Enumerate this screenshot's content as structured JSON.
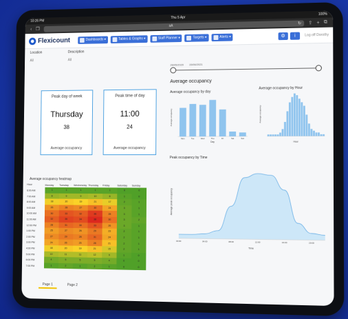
{
  "status": {
    "time": "10:26 PM",
    "date": "Thu 5 Apr",
    "battery": "100%"
  },
  "browser": {
    "url": "aA",
    "reload_icon": "reload-icon"
  },
  "app": {
    "name": "Flexicount"
  },
  "nav": {
    "items": [
      {
        "label": "Dashboards ▾"
      },
      {
        "label": "Tables & Graphs ▾"
      },
      {
        "label": "Staff Planner ▾"
      },
      {
        "label": "Targets ▾"
      },
      {
        "label": "Alerts ▾"
      }
    ],
    "settings_icon": "gear-icon",
    "info_label": "i",
    "logout_label": "Log off Dorothy"
  },
  "filters": {
    "location_label": "Location",
    "location_value": "All",
    "description_label": "Description",
    "description_value": "All"
  },
  "date_range": {
    "start": "26/05/2020",
    "end": "15/06/2021"
  },
  "kpis": [
    {
      "title": "Peak day of week",
      "main": "Thursday",
      "value": "38",
      "foot": "Average occupancy"
    },
    {
      "title": "Peak time of day",
      "main": "11:00",
      "value": "24",
      "foot": "Average occupancy"
    }
  ],
  "section_title": "Average occupancy",
  "by_day_title": "Average occupancy by day",
  "by_hour_title": "Average occupancy by Hour",
  "by_time_title": "Peak occupancy by Time",
  "heatmap": {
    "title": "Average occupancy heatmap",
    "corner": "Hour",
    "days": [
      "Monday",
      "Tuesday",
      "Wednesday",
      "Thursday",
      "Friday",
      "Saturday",
      "Sunday"
    ],
    "hours": [
      "6:00 AM",
      "7:00 AM",
      "8:00 AM",
      "9:00 AM",
      "10:00 AM",
      "11:00 AM",
      "12:00 PM",
      "1:00 PM",
      "2:00 PM",
      "3:00 PM",
      "4:00 PM",
      "5:00 PM",
      "6:00 PM",
      "7:00 PM"
    ],
    "values": [
      [
        1,
        1,
        1,
        1,
        1,
        0,
        0
      ],
      [
        8,
        9,
        9,
        10,
        8,
        1,
        0
      ],
      [
        18,
        20,
        19,
        21,
        17,
        2,
        1
      ],
      [
        26,
        28,
        27,
        30,
        24,
        3,
        1
      ],
      [
        30,
        33,
        32,
        36,
        28,
        3,
        1
      ],
      [
        32,
        35,
        34,
        38,
        30,
        3,
        2
      ],
      [
        28,
        31,
        30,
        33,
        26,
        3,
        1
      ],
      [
        25,
        27,
        26,
        29,
        23,
        2,
        1
      ],
      [
        27,
        29,
        28,
        31,
        24,
        2,
        1
      ],
      [
        24,
        26,
        25,
        28,
        21,
        2,
        1
      ],
      [
        18,
        20,
        19,
        21,
        15,
        2,
        1
      ],
      [
        10,
        11,
        11,
        12,
        9,
        1,
        0
      ],
      [
        4,
        5,
        5,
        5,
        4,
        0,
        0
      ],
      [
        1,
        2,
        1,
        2,
        1,
        0,
        0
      ]
    ]
  },
  "chart_data": [
    {
      "type": "bar",
      "title": "Average occupancy by day",
      "xlabel": "Day",
      "ylabel": "Average occupancy",
      "categories": [
        "Monday",
        "Tuesday",
        "Wednesday",
        "Thursday",
        "Friday",
        "Saturday",
        "Sunday"
      ],
      "values": [
        30,
        34,
        33,
        38,
        28,
        5,
        4
      ],
      "ylim": [
        0,
        40
      ]
    },
    {
      "type": "bar",
      "title": "Average occupancy by Hour",
      "xlabel": "Hour",
      "ylabel": "Average occupancy",
      "categories": [
        "0",
        "1",
        "2",
        "3",
        "4",
        "5",
        "6",
        "7",
        "8",
        "9",
        "10",
        "11",
        "12",
        "13",
        "14",
        "15",
        "16",
        "17",
        "18",
        "19",
        "20",
        "21",
        "22",
        "23"
      ],
      "values": [
        1,
        1,
        1,
        1,
        1,
        2,
        4,
        8,
        14,
        19,
        22,
        24,
        23,
        21,
        19,
        17,
        12,
        7,
        4,
        3,
        2,
        2,
        1,
        1
      ],
      "ylim": [
        0,
        25
      ]
    },
    {
      "type": "area",
      "title": "Peak occupancy by Time",
      "xlabel": "Time",
      "ylabel": "Average peak occupancy",
      "x": [
        "00:00",
        "02:00",
        "04:00",
        "06:00",
        "08:00",
        "10:00",
        "12:00",
        "14:00",
        "16:00",
        "18:00",
        "20:00",
        "22:00"
      ],
      "values": [
        5,
        5,
        6,
        10,
        40,
        75,
        80,
        78,
        60,
        20,
        8,
        6
      ],
      "ylim": [
        0,
        90
      ]
    }
  ],
  "tabs": [
    {
      "label": "Page 1"
    },
    {
      "label": "Page 2"
    }
  ]
}
